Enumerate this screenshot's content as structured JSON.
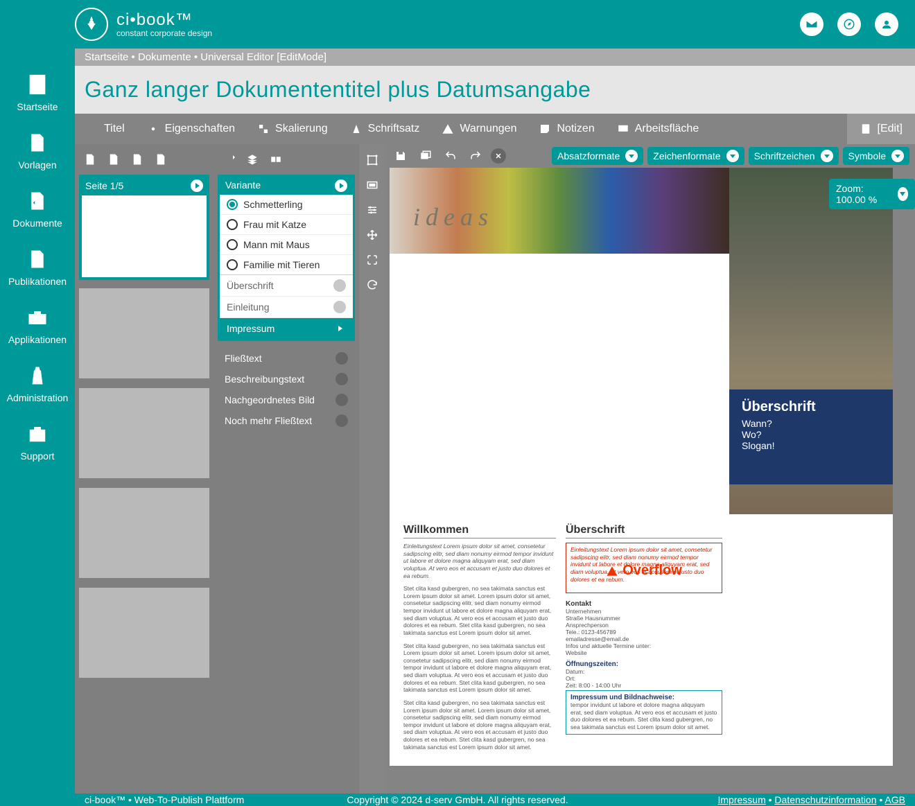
{
  "brand": {
    "title": "ci•book™",
    "tagline": "constant corporate design"
  },
  "nav": [
    "Startseite",
    "Vorlagen",
    "Dokumente",
    "Publikationen",
    "Applikationen",
    "Administration",
    "Support"
  ],
  "breadcrumb": "Startseite • Dokumente • Universal Editor [EditMode]",
  "document_title": "Ganz langer Dokumententitel plus Datumsangabe",
  "tabs": [
    "Titel",
    "Eigenschaften",
    "Skalierung",
    "Schriftsatz",
    "Warnungen",
    "Notizen",
    "Arbeitsfläche"
  ],
  "mode_tab": "[Edit]",
  "page_label": "Seite 1/5",
  "variante": {
    "head": "Variante",
    "variants": [
      "Schmetterling",
      "Frau mit Katze",
      "Mann mit Maus",
      "Familie mit Tieren"
    ],
    "selected": 0,
    "sections": [
      "Überschrift",
      "Einleitung",
      "Impressum"
    ],
    "sections_selected": 2
  },
  "extra_sections": [
    "Fließtext",
    "Beschreibungstext",
    "Nachgeordnetes Bild",
    "Noch mehr Fließtext"
  ],
  "canvas_dropdowns": [
    "Absatzformate",
    "Zeichenformate",
    "Schriftzeichen",
    "Symbole"
  ],
  "zoom": "Zoom: 100.00 %",
  "doc": {
    "left_head": "Willkommen",
    "right_head": "Überschrift",
    "intro": "Einleitungstext Lorem ipsum dolor sit amet, consetetur sadipscing elitr, sed diam nonumy eirmod tempor invidunt ut labore et dolore magna aliquyam erat, sed diam voluptua. At vero eos et accusam et justo duo dolores et ea rebum.",
    "body1": "Stet clita kasd gubergren, no sea takimata sanctus est Lorem ipsum dolor sit amet. Lorem ipsum dolor sit amet, consetetur sadipscing elitr, sed diam nonumy eirmod tempor invidunt ut labore et dolore magna aliquyam erat, sed diam voluptua. At vero eos et accusam et justo duo dolores et ea rebum. Stet clita kasd gubergren, no sea takimata sanctus est Lorem ipsum dolor sit amet.",
    "body2": "Stet clita kasd gubergren, no sea takimata sanctus est Lorem ipsum dolor sit amet. Lorem ipsum dolor sit amet, consetetur sadipscing elitr, sed diam nonumy eirmod tempor invidunt ut labore et dolore magna aliquyam erat, sed diam voluptua. At vero eos et accusam et justo duo dolores et ea rebum. Stet clita kasd gubergren, no sea takimata sanctus est Lorem ipsum dolor sit amet.",
    "body3": "Stet clita kasd gubergren, no sea takimata sanctus est Lorem ipsum dolor sit amet. Lorem ipsum dolor sit amet, consetetur sadipscing elitr, sed diam nonumy eirmod tempor invidunt ut labore et dolore magna aliquyam erat, sed diam voluptua. At vero eos et accusam et justo duo dolores et ea rebum. Stet clita kasd gubergren, no sea takimata sanctus est Lorem ipsum dolor sit amet.",
    "overflow_text_italic": "Einleitungstext Lorem ipsum dolor sit amet, consetetur sadipscing elitr, sed diam nonumy eirmod tempor invidunt ut labore et dolore magna aliquyam erat, sed diam voluptua. At vero eos et accusam et justo duo dolores et ea rebum.",
    "overflow_label": "Overflow",
    "kontakt_head": "Kontakt",
    "kontakt_lines": [
      "Unternehmen",
      "Straße Hausnummer",
      "Ansprechperson",
      "Tele.: 0123-456789",
      "emailadresse@email.de",
      "Infos und aktuelle Termine unter:",
      "Website"
    ],
    "oeff_head": "Öffnungszeiten:",
    "oeff_lines": [
      "Datum:",
      "Ort:",
      "Zeit: 8:00 - 14:00 Uhr"
    ],
    "impress_head": "Impressum und Bildnachweise:",
    "impress_body": "tempor invidunt ut labore et dolore magna aliquyam erat, sed diam voluptua. At vero eos et accusam et justo duo dolores et ea rebum. Stet clita kasd gubergren, no sea takimata sanctus est Lorem ipsum dolor sit amet.",
    "side_title": "Überschrift",
    "side_lines": [
      "Wann?",
      "Wo?",
      "Slogan!"
    ]
  },
  "footer": {
    "left": "ci-book™ • Web-To-Publish Plattform",
    "mid": "Copyright © 2024 d-serv GmbH. All rights reserved.",
    "links": [
      "Impressum",
      "Datenschutzinformation",
      "AGB"
    ]
  }
}
